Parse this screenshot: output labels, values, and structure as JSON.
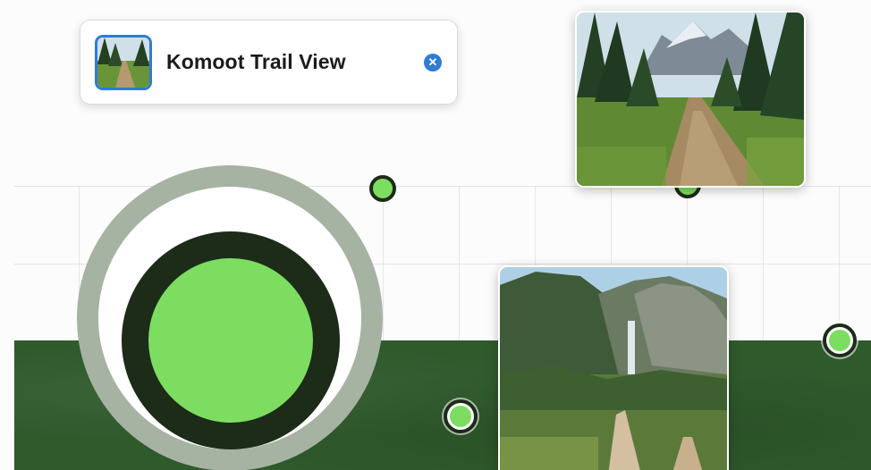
{
  "card": {
    "title": "Komoot Trail View",
    "close_icon": "close-circle-icon"
  },
  "colors": {
    "accent": "#2f7bd6",
    "marker_fill": "#7ddd60",
    "marker_ring": "#1d2b19",
    "terrain": "#2f5a2c"
  },
  "map": {
    "markers": [
      "selected-location-marker",
      "waypoint-marker",
      "waypoint-marker",
      "waypoint-marker",
      "waypoint-marker"
    ],
    "photos": [
      "mountain-trail-photo",
      "waterfall-valley-photo"
    ]
  }
}
